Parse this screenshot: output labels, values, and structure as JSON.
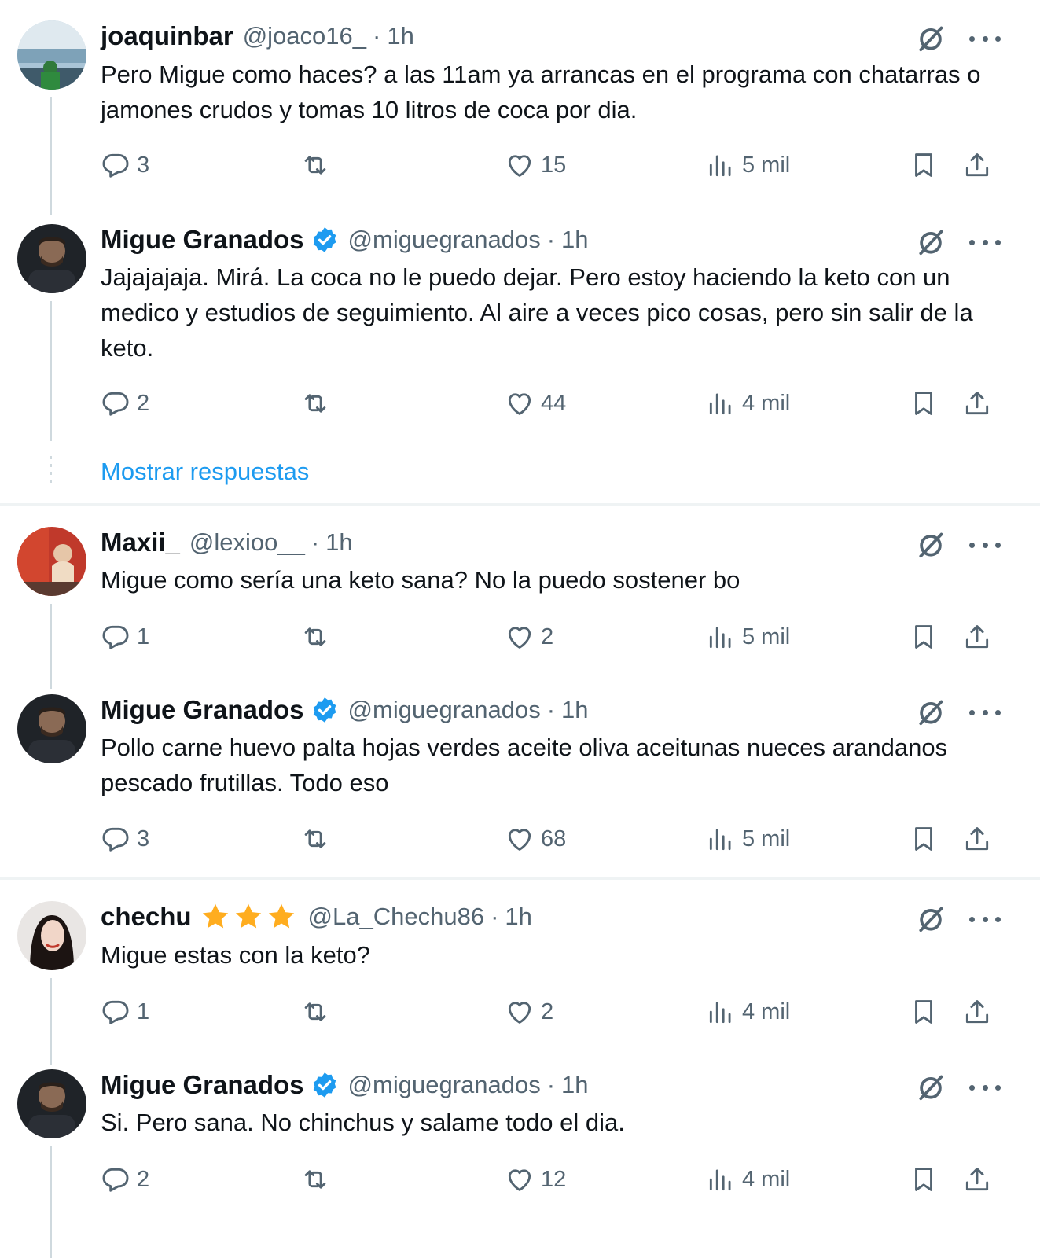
{
  "colors": {
    "accent": "#1d9bf0",
    "muted": "#536471",
    "text": "#0f1419",
    "star": "#ffad1f",
    "verified": "#1d9bf0"
  },
  "show_replies_label": "Mostrar respuestas",
  "tweets": [
    {
      "name": "joaquinbar",
      "handle": "@joaco16_",
      "sep": "·",
      "time": "1h",
      "text": "Pero Migue como haces? a las 11am ya arrancas en el programa con chatarras o jamones crudos y tomas 10 litros de coca por dia.",
      "replies": "3",
      "retweets": "",
      "likes": "15",
      "views": "5 mil"
    },
    {
      "name": "Migue Granados",
      "handle": "@miguegranados",
      "sep": "·",
      "time": "1h",
      "verified": true,
      "text": "Jajajajaja. Mirá. La coca no le puedo dejar. Pero estoy haciendo la keto con un medico y estudios de seguimiento. Al aire a veces pico cosas, pero sin salir de la keto.",
      "replies": "2",
      "retweets": "",
      "likes": "44",
      "views": "4 mil"
    },
    {
      "name": "Maxii_",
      "handle": "@lexioo__",
      "sep": "·",
      "time": "1h",
      "text": "Migue como sería una keto sana? No la puedo sostener bo",
      "replies": "1",
      "retweets": "",
      "likes": "2",
      "views": "5 mil"
    },
    {
      "name": "Migue Granados",
      "handle": "@miguegranados",
      "sep": "·",
      "time": "1h",
      "verified": true,
      "text": "Pollo carne huevo palta hojas verdes aceite oliva aceitunas nueces arandanos pescado frutillas. Todo eso",
      "replies": "3",
      "retweets": "",
      "likes": "68",
      "views": "5 mil"
    },
    {
      "name": "chechu",
      "handle": "@La_Chechu86",
      "sep": "·",
      "time": "1h",
      "stars": 3,
      "text": "Migue estas con la keto?",
      "replies": "1",
      "retweets": "",
      "likes": "2",
      "views": "4 mil"
    },
    {
      "name": "Migue Granados",
      "handle": "@miguegranados",
      "sep": "·",
      "time": "1h",
      "verified": true,
      "text": "Si. Pero sana. No chinchus y salame todo el dia.",
      "replies": "2",
      "retweets": "",
      "likes": "12",
      "views": "4 mil"
    }
  ]
}
